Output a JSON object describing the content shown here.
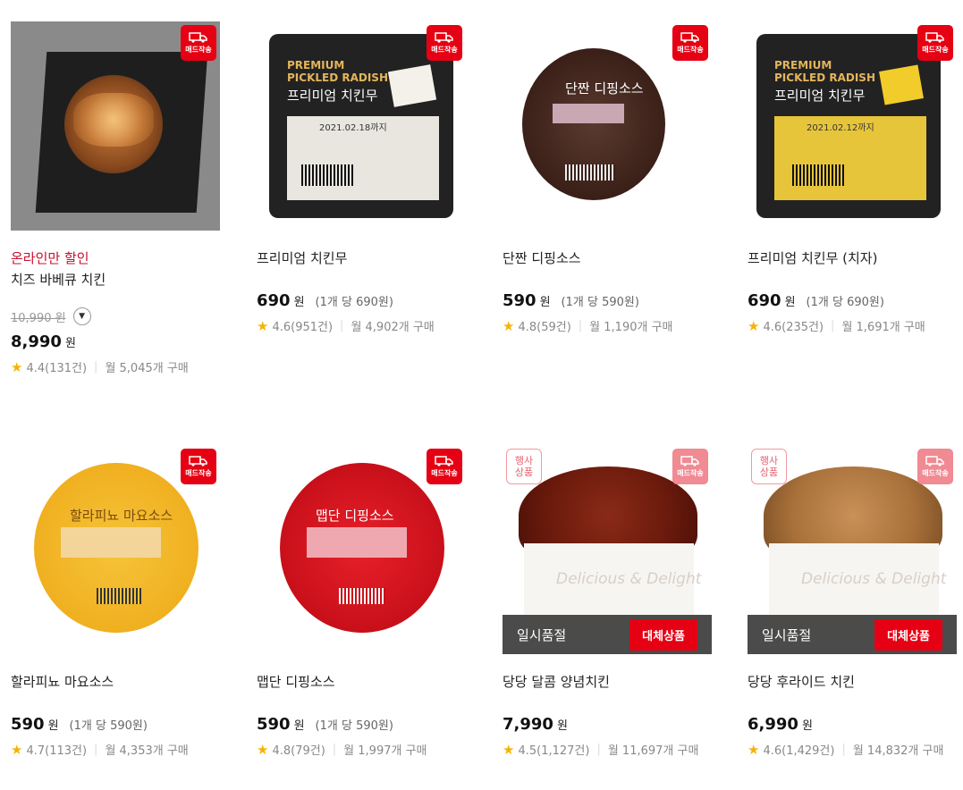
{
  "badges": {
    "delivery": "매드작송",
    "event_line1": "행사",
    "event_line2": "상품"
  },
  "soldout": {
    "label": "일시품절",
    "alt_button": "대체상품"
  },
  "products": [
    {
      "promo": "온라인만 할인",
      "name": "치즈 바베큐 치킨",
      "original_price": "10,990 원",
      "price": "8,990",
      "won": "원",
      "unit": "",
      "rating": "4.4(131건)",
      "monthly": "월 5,045개 구매"
    },
    {
      "promo": "",
      "name": "프리미엄 치킨무",
      "original_price": "",
      "price": "690",
      "won": "원",
      "unit": "(1개 당 690원)",
      "rating": "4.6(951건)",
      "monthly": "월 4,902개 구매",
      "pkg_en1": "PREMIUM",
      "pkg_en2": "PICKLED RADISH",
      "pkg_kr": "프리미엄 치킨무",
      "pkg_date": "2021.02.18까지"
    },
    {
      "promo": "",
      "name": "단짠 디핑소스",
      "original_price": "",
      "price": "590",
      "won": "원",
      "unit": "(1개 당 590원)",
      "rating": "4.8(59건)",
      "monthly": "월 1,190개 구매",
      "pkg_kr": "단짠 디핑소스"
    },
    {
      "promo": "",
      "name": "프리미엄 치킨무 (치자)",
      "original_price": "",
      "price": "690",
      "won": "원",
      "unit": "(1개 당 690원)",
      "rating": "4.6(235건)",
      "monthly": "월 1,691개 구매",
      "pkg_en1": "PREMIUM",
      "pkg_en2": "PICKLED RADISH",
      "pkg_kr": "프리미엄 치킨무",
      "pkg_date": "2021.02.12까지"
    },
    {
      "promo": "",
      "name": "할라피뇨 마요소스",
      "original_price": "",
      "price": "590",
      "won": "원",
      "unit": "(1개 당 590원)",
      "rating": "4.7(113건)",
      "monthly": "월 4,353개 구매",
      "pkg_kr": "할라피뇨 마요소스"
    },
    {
      "promo": "",
      "name": "맵단 디핑소스",
      "original_price": "",
      "price": "590",
      "won": "원",
      "unit": "(1개 당 590원)",
      "rating": "4.8(79건)",
      "monthly": "월 1,997개 구매",
      "pkg_kr": "맵단 디핑소스"
    },
    {
      "promo": "",
      "name": "당당 달콤 양념치킨",
      "original_price": "",
      "price": "7,990",
      "won": "원",
      "unit": "",
      "rating": "4.5(1,127건)",
      "monthly": "월 11,697개 구매",
      "cup_text": "Delicious & Delight"
    },
    {
      "promo": "",
      "name": "당당 후라이드 치킨",
      "original_price": "",
      "price": "6,990",
      "won": "원",
      "unit": "",
      "rating": "4.6(1,429건)",
      "monthly": "월 14,832개 구매",
      "cup_text": "Delicious & Delight"
    }
  ],
  "colors": {
    "brand_red": "#e60013",
    "promo_red": "#c8102e",
    "star": "#f5b301"
  },
  "icons": {
    "delivery": "truck-icon",
    "star": "star-icon",
    "toggle": "chevron-down-icon"
  }
}
